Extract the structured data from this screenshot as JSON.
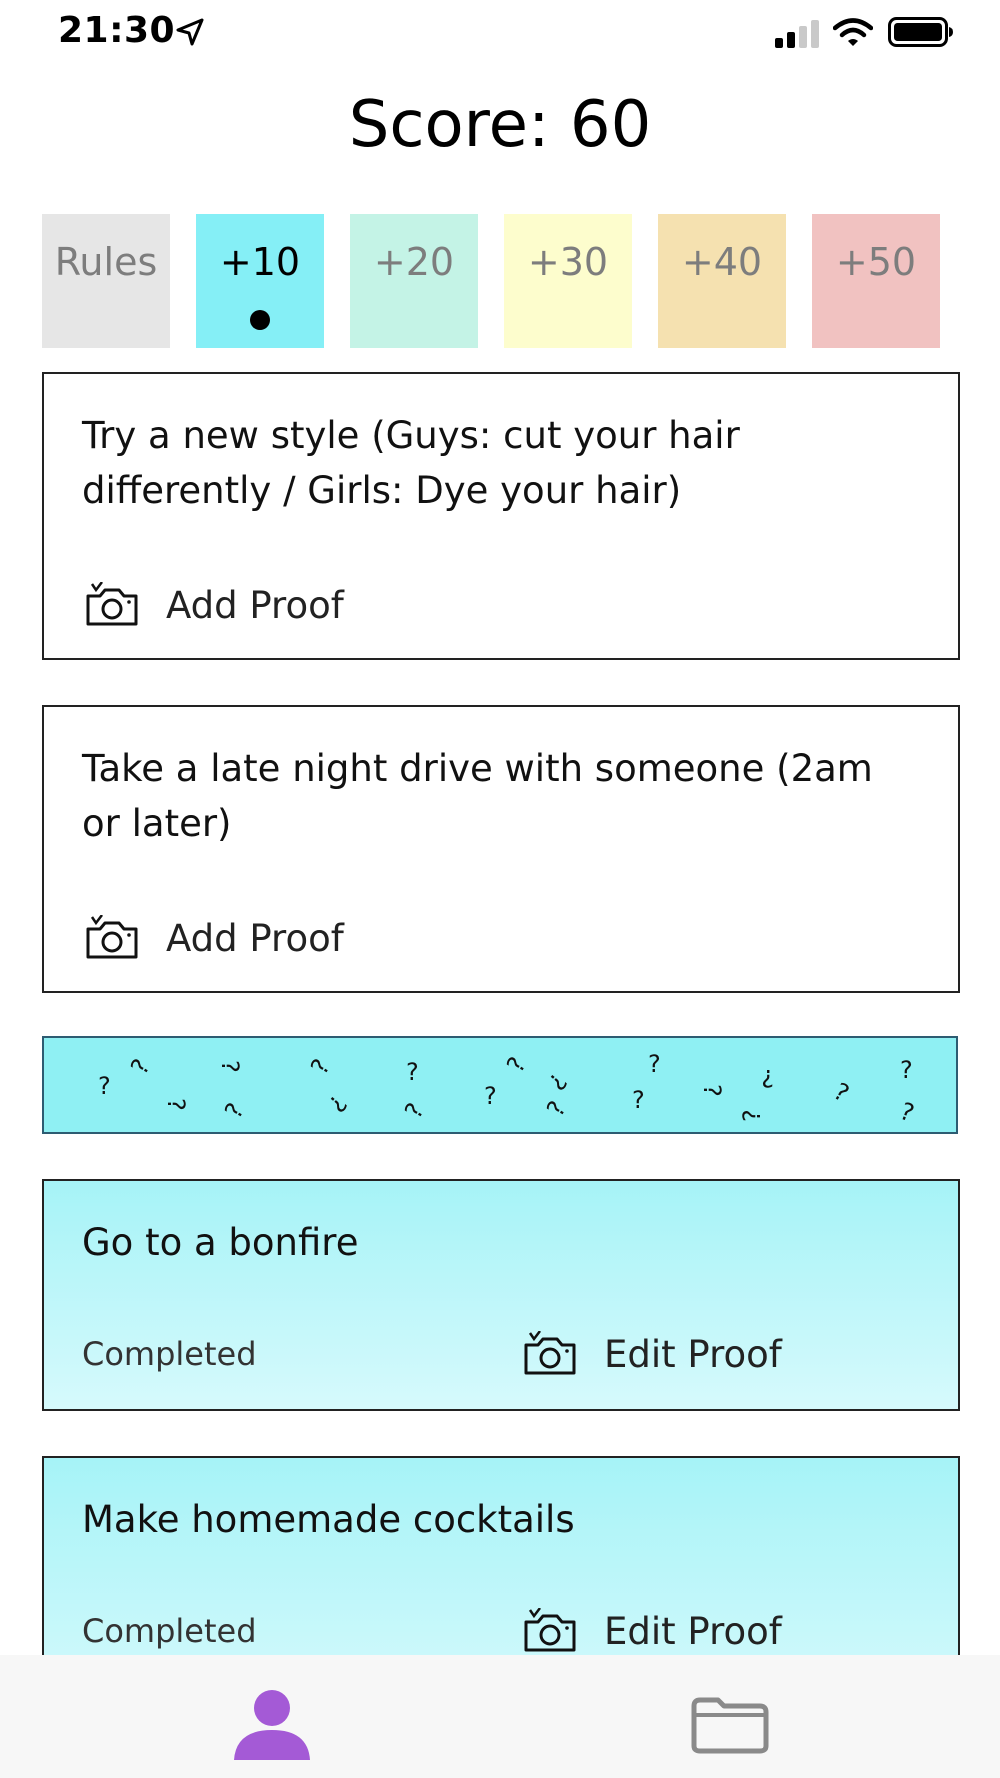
{
  "status_bar": {
    "time": "21:30",
    "icons": [
      "location-arrow-icon",
      "signal-icon",
      "wifi-icon",
      "battery-icon"
    ]
  },
  "score": {
    "label": "Score: 60"
  },
  "tabs": [
    {
      "label": "Rules",
      "color": "#e6e6e6",
      "active": false
    },
    {
      "label": "+10",
      "color": "#85eff6",
      "active": true
    },
    {
      "label": "+20",
      "color": "#c4f3e6",
      "active": false
    },
    {
      "label": "+30",
      "color": "#fdfdcd",
      "active": false
    },
    {
      "label": "+40",
      "color": "#f5e1b0",
      "active": false
    },
    {
      "label": "+50",
      "color": "#f1c2c1",
      "active": false
    }
  ],
  "challenges": [
    {
      "title": "Try a new style (Guys: cut your hair differently / Girls: Dye your hair)",
      "proof_label": "Add Proof"
    },
    {
      "title": "Take a late night drive with someone (2am or later)",
      "proof_label": "Add Proof"
    }
  ],
  "mystery_banner": {
    "color": "#8ff0f3",
    "pattern": "question-marks"
  },
  "completed_challenges": [
    {
      "title": "Go to a bonfire",
      "status": "Completed",
      "proof_label": "Edit Proof"
    },
    {
      "title": "Make homemade cocktails",
      "status": "Completed",
      "proof_label": "Edit Proof"
    }
  ],
  "bottom_nav": {
    "items": [
      {
        "icon": "profile-icon",
        "color": "#a45ad6",
        "active": true
      },
      {
        "icon": "folder-icon",
        "color": "#8a8a8a",
        "active": false
      }
    ]
  }
}
